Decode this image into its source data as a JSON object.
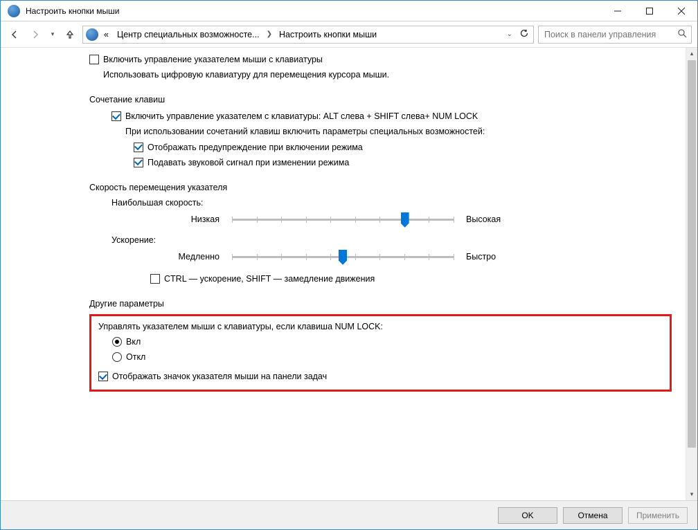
{
  "window": {
    "title": "Настроить кнопки мыши"
  },
  "breadcrumb": {
    "seg1": "Центр специальных возможносте...",
    "seg2": "Настроить кнопки мыши"
  },
  "search": {
    "placeholder": "Поиск в панели управления"
  },
  "topCheck": {
    "label": "Включить управление указателем мыши с клавиатуры"
  },
  "topDesc": "Использовать цифровую клавиатуру для перемещения курсора мыши.",
  "section1": {
    "title": "Сочетание клавиш",
    "enable": "Включить управление указателем с клавиатуры: ALT слева + SHIFT слева+ NUM LOCK",
    "desc": "При использовании сочетаний клавиш включить параметры специальных возможностей:",
    "opt1": "Отображать предупреждение при включении режима",
    "opt2": "Подавать звуковой сигнал при изменении режима"
  },
  "section2": {
    "title": "Скорость перемещения указателя",
    "speedLabel": "Наибольшая скорость:",
    "low": "Низкая",
    "high": "Высокая",
    "accelLabel": "Ускорение:",
    "slow": "Медленно",
    "fast": "Быстро",
    "ctrlShift": "CTRL — ускорение, SHIFT — замедление движения"
  },
  "section3": {
    "title": "Другие параметры",
    "numlockLabel": "Управлять указателем мыши с клавиатуры, если клавиша NUM LOCK:",
    "on": "Вкл",
    "off": "Откл",
    "showIcon": "Отображать значок указателя мыши на панели задач"
  },
  "footer": {
    "ok": "OK",
    "cancel": "Отмена",
    "apply": "Применить"
  }
}
